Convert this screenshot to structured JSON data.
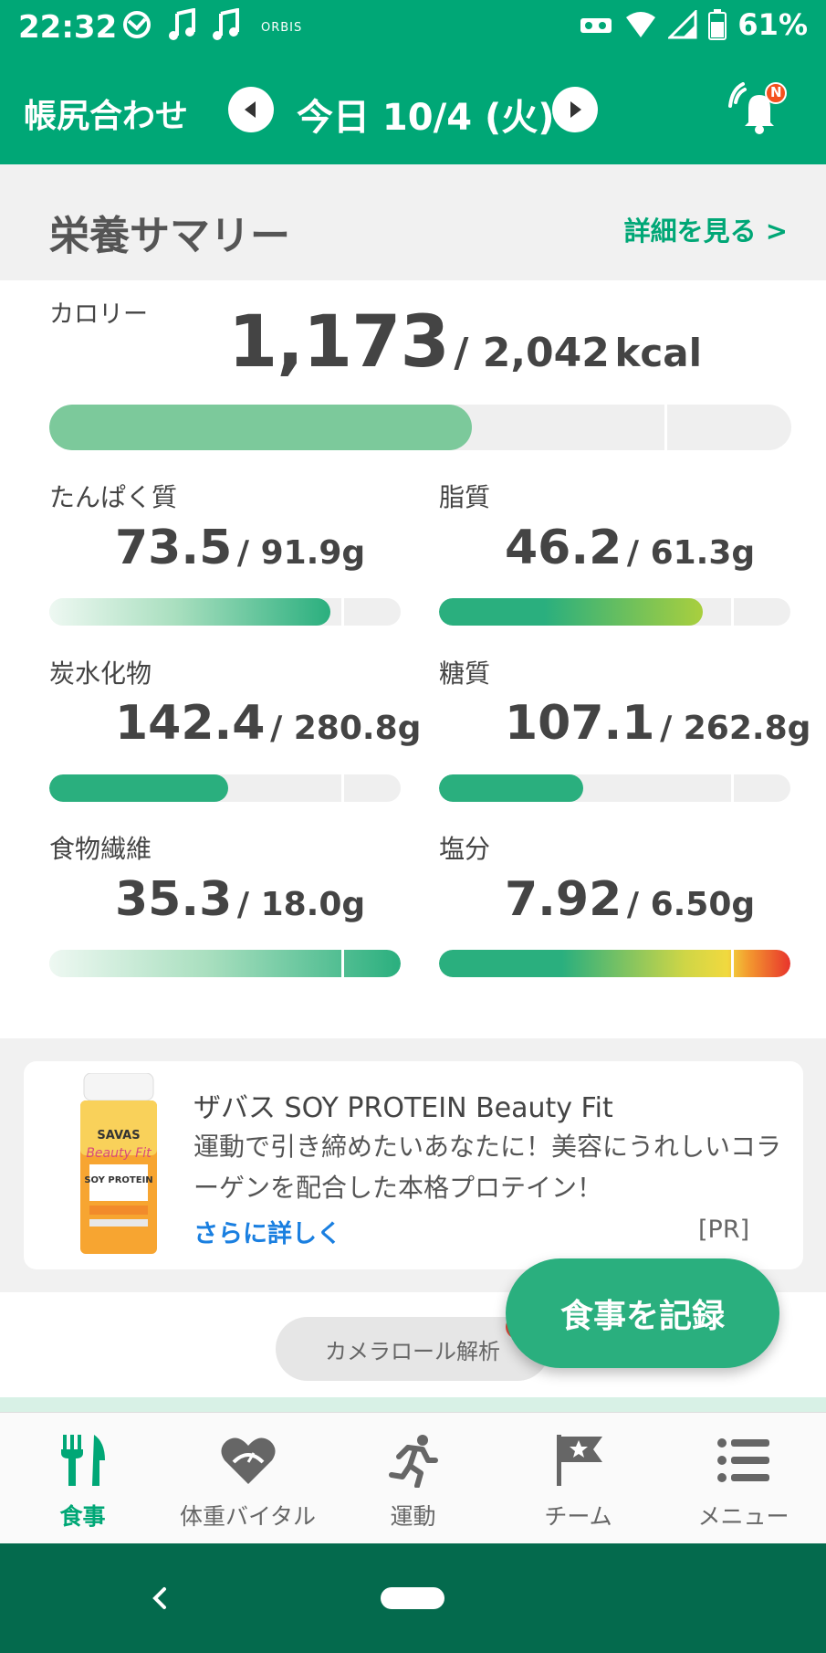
{
  "status_bar": {
    "time": "22:32",
    "carrier_label": "ORBIS",
    "battery_percent": "61%"
  },
  "app_bar": {
    "title": "帳尻合わせ",
    "date": "今日 10/4 (火)",
    "notification_badge": "N"
  },
  "summary": {
    "heading": "栄養サマリー",
    "detail_link": "詳細を見る >"
  },
  "calories": {
    "label": "カロリー",
    "value": "1,173",
    "target": "/ 2,042",
    "unit": "kcal",
    "progress": 0.574
  },
  "nutrients": [
    {
      "label": "たんぱく質",
      "value": "73.5",
      "target": "/ 91.9g",
      "progress": 0.8,
      "style": "fade-mint"
    },
    {
      "label": "脂質",
      "value": "46.2",
      "target": "/ 61.3g",
      "progress": 0.75,
      "style": "green-lime"
    },
    {
      "label": "炭水化物",
      "value": "142.4",
      "target": "/ 280.8g",
      "progress": 0.51,
      "style": "solid-green"
    },
    {
      "label": "糖質",
      "value": "107.1",
      "target": "/ 262.8g",
      "progress": 0.41,
      "style": "solid-green"
    },
    {
      "label": "食物繊維",
      "value": "35.3",
      "target": "/ 18.0g",
      "progress": 1.0,
      "style": "fade-mint"
    },
    {
      "label": "塩分",
      "value": "7.92",
      "target": "/ 6.50g",
      "progress": 1.0,
      "style": "green-yellow-red"
    }
  ],
  "ad": {
    "title": "ザバス SOY PROTEIN Beauty Fit",
    "body": "運動で引き締めたいあなたに！美容にうれしいコラーゲンを配合した本格プロテイン！",
    "link": "さらに詳しく",
    "pr": "[PR]",
    "product_text_brand": "SAVAS",
    "product_text_line": "Beauty Fit",
    "product_text_name": "SOY PROTEIN"
  },
  "camera_button": "カメラロール解析",
  "record_button": "食事を記録",
  "bottom_nav": [
    {
      "label": "食事",
      "icon": "fork-knife-icon",
      "active": true
    },
    {
      "label": "体重バイタル",
      "icon": "heart-scale-icon",
      "active": false
    },
    {
      "label": "運動",
      "icon": "running-icon",
      "active": false
    },
    {
      "label": "チーム",
      "icon": "flag-star-icon",
      "active": false
    },
    {
      "label": "メニュー",
      "icon": "menu-list-icon",
      "active": false
    }
  ],
  "colors": {
    "brand_green": "#00a776",
    "system_nav": "#046a4d",
    "link_blue": "#1a7fe0"
  }
}
